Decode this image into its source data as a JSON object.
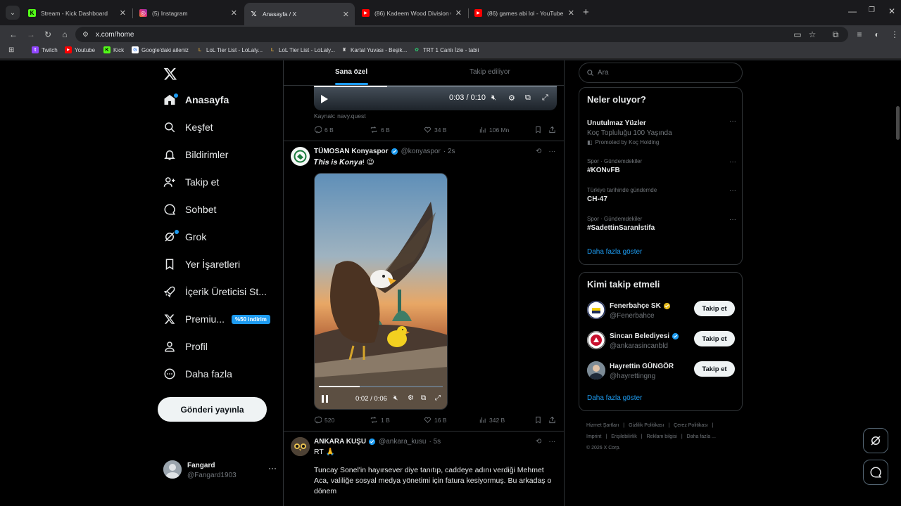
{
  "browser": {
    "tabs": [
      {
        "title": "Stream - Kick Dashboard",
        "icon": "kick-icon",
        "color": "#53fc18"
      },
      {
        "title": "(5) Instagram",
        "icon": "instagram-icon",
        "color": "#e1306c"
      },
      {
        "title": "Anasayfa / X",
        "icon": "x-icon",
        "color": "#ffffff"
      },
      {
        "title": "(86) Kadeem Wood Division Co",
        "icon": "youtube-icon",
        "color": "#ff0000"
      },
      {
        "title": "(86) games abi lol - YouTube",
        "icon": "youtube-icon",
        "color": "#ff0000"
      }
    ],
    "active_tab": 2,
    "url": "x.com/home",
    "bookmarks": [
      {
        "label": "Twitch",
        "icon": "twitch-icon",
        "color": "#9146ff"
      },
      {
        "label": "Youtube",
        "icon": "youtube-icon",
        "color": "#ff0000"
      },
      {
        "label": "Kick",
        "icon": "kick-icon",
        "color": "#53fc18"
      },
      {
        "label": "Google'daki aileniz",
        "icon": "google-icon",
        "color": "#4285f4"
      },
      {
        "label": "LoL Tier List - LoLaly...",
        "icon": "lolalytics-icon",
        "color": "#c89b3c"
      },
      {
        "label": "LoL Tier List - LoLaly...",
        "icon": "lolalytics-icon",
        "color": "#c89b3c"
      },
      {
        "label": "Kartal Yuvası - Beşik...",
        "icon": "besiktas-icon",
        "color": "#888888"
      },
      {
        "label": "TRT 1 Canlı İzle - tabii",
        "icon": "tabii-icon",
        "color": "#2ecc71"
      }
    ]
  },
  "nav": {
    "items": [
      {
        "label": "Anasayfa",
        "icon": "home-icon"
      },
      {
        "label": "Keşfet",
        "icon": "search-icon"
      },
      {
        "label": "Bildirimler",
        "icon": "bell-icon"
      },
      {
        "label": "Takip et",
        "icon": "follow-icon"
      },
      {
        "label": "Sohbet",
        "icon": "chat-icon"
      },
      {
        "label": "Grok",
        "icon": "grok-icon"
      },
      {
        "label": "Yer İşaretleri",
        "icon": "bookmark-icon"
      },
      {
        "label": "İçerik Üreticisi St...",
        "icon": "rocket-icon"
      },
      {
        "label": "Premiu...",
        "icon": "x-premium-icon"
      },
      {
        "label": "Profil",
        "icon": "profile-icon"
      },
      {
        "label": "Daha fazla",
        "icon": "more-circle-icon"
      }
    ],
    "premium_badge": "%50 indirim",
    "post_button": "Gönderi yayınla",
    "account": {
      "name": "Fangard",
      "handle": "@Fangard1903"
    }
  },
  "feed": {
    "tabs": [
      "Sana özel",
      "Takip ediliyor"
    ],
    "video1": {
      "time": "0:03 / 0:10",
      "progress": 0.3
    },
    "source": "Kaynak: navy.quest",
    "tweet0_actions": {
      "replies": "6 B",
      "reposts": "6 B",
      "likes": "34 B",
      "views": "106 Mn"
    },
    "tweet1": {
      "name": "TÜMOSAN Konyaspor",
      "handle": "@konyaspor",
      "time": "· 2s",
      "text": "𝑻𝒉𝒊𝒔 𝒊𝒔 𝑲𝒐𝒏𝒚𝒂! 😉",
      "video_time": "0:02 / 0:06",
      "video_progress": 0.33,
      "actions": {
        "replies": "520",
        "reposts": "1 B",
        "likes": "16 B",
        "views": "342 B"
      }
    },
    "tweet2": {
      "name": "ANKARA KUŞU",
      "handle": "@ankara_kusu",
      "time": "· 5s",
      "line1": "RT 🙏",
      "line2": "Tuncay Sonel'in hayırsever diye tanıtıp, caddeye adını verdiği Mehmet Aca, valiliğe sosyal medya yönetimi için fatura kesiyormuş. Bu arkadaş o dönem"
    }
  },
  "right": {
    "search_placeholder": "Ara",
    "trends_title": "Neler oluyor?",
    "trends": [
      {
        "context": "",
        "title": "Unutulmaz Yüzler",
        "sub": "Koç Topluluğu 100 Yaşında",
        "promoted": "Promoted by Koç Holding"
      },
      {
        "context": "Spor · Gündemdekiler",
        "title": "#KONvFB",
        "sub": "",
        "promoted": ""
      },
      {
        "context": "Türkiye tarihinde gündemde",
        "title": "CH-47",
        "sub": "",
        "promoted": ""
      },
      {
        "context": "Spor · Gündemdekiler",
        "title": "#SadettinSaranİstifa",
        "sub": "",
        "promoted": ""
      }
    ],
    "show_more": "Daha fazla göster",
    "who_title": "Kimi takip etmeli",
    "who": [
      {
        "name": "Fenerbahçe SK",
        "handle": "@Fenerbahce",
        "badge": "gold"
      },
      {
        "name": "Sincan Belediyesi",
        "handle": "@ankarasincanbld",
        "badge": "blue"
      },
      {
        "name": "Hayrettin GÜNGÖR",
        "handle": "@hayrettingng",
        "badge": ""
      }
    ],
    "follow_label": "Takip et",
    "footer": [
      "Hizmet Şartları",
      "|",
      "Gizlilik Politikası",
      "|",
      "Çerez Politikası",
      "|",
      "Imprint",
      "|",
      "Erişilebilirlik",
      "|",
      "Reklam bilgisi",
      "|",
      "Daha fazla ...",
      "© 2026 X Corp."
    ]
  }
}
